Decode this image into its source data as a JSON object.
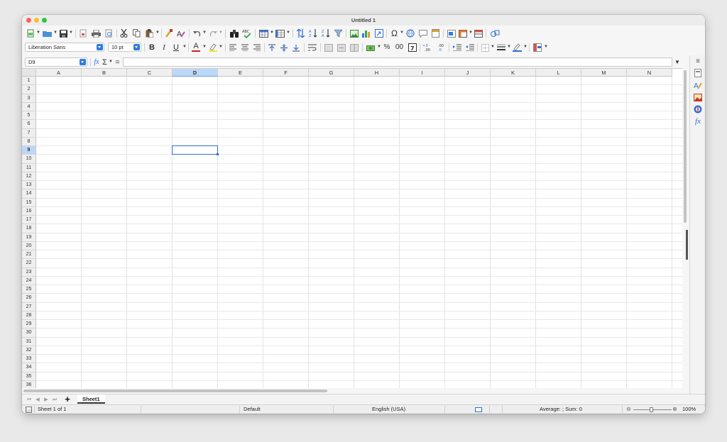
{
  "window": {
    "title": "Untitled 1"
  },
  "font": {
    "name": "Liberation Sans",
    "size": "10 pt"
  },
  "formula_bar": {
    "name_box": "D9",
    "fx": "fx",
    "sigma": "Σ",
    "equals": "=",
    "formula": ""
  },
  "toolbar": {
    "bold": "B",
    "italic": "I",
    "underline": "U",
    "font_color": "A",
    "percent": "%",
    "number_format": "00",
    "omega": "Ω",
    "abc": "ABC"
  },
  "columns": [
    "A",
    "B",
    "C",
    "D",
    "E",
    "F",
    "G",
    "H",
    "I",
    "J",
    "K",
    "L",
    "M",
    "N"
  ],
  "rows": [
    "1",
    "2",
    "3",
    "4",
    "5",
    "6",
    "7",
    "8",
    "9",
    "10",
    "11",
    "12",
    "13",
    "14",
    "15",
    "16",
    "17",
    "18",
    "19",
    "20",
    "21",
    "22",
    "23",
    "24",
    "25",
    "26",
    "27",
    "28",
    "29",
    "30",
    "31",
    "32",
    "33",
    "34",
    "35",
    "36"
  ],
  "selection": {
    "column": "D",
    "row": "9"
  },
  "sheets": {
    "tabs": [
      "Sheet1"
    ],
    "active": "Sheet1",
    "add": "+"
  },
  "status": {
    "sheet": "Sheet 1 of 1",
    "style": "Default",
    "language": "English (USA)",
    "summary": "Average: ; Sum: 0",
    "zoom": "100%"
  },
  "sidebar": {
    "menu": "≡",
    "functions": "fx"
  },
  "colors": {
    "accent": "#2f7be0",
    "selection_header": "#bdd7f7",
    "cursor": "#2f6fd6"
  }
}
